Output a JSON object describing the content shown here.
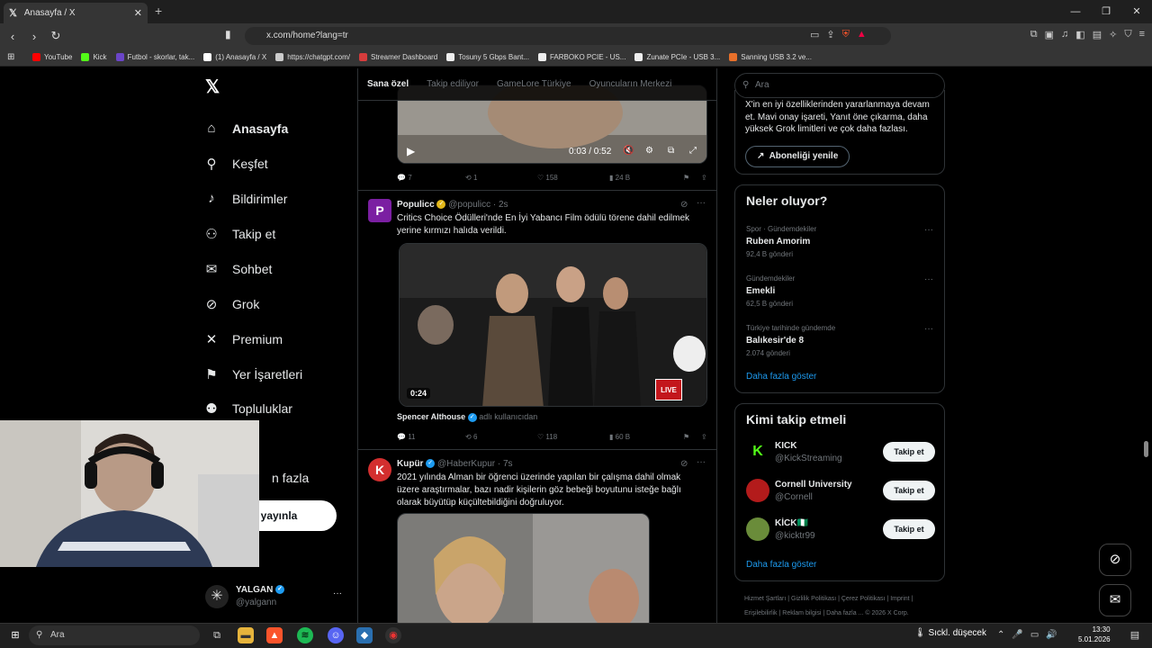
{
  "browser": {
    "tab_title": "Anasayfa / X",
    "tab_close": "✕",
    "new_tab": "+",
    "url": "x.com/home?lang=tr",
    "bookmarks": [
      {
        "label": "YouTube",
        "color": "#ff0000"
      },
      {
        "label": "Kick",
        "color": "#53fc18"
      },
      {
        "label": "Futbol - skorlar, tak...",
        "color": "#6b45c8"
      },
      {
        "label": "(1) Anasayfa / X",
        "color": "#ffffff"
      },
      {
        "label": "https://chatgpt.com/",
        "color": "#cccccc"
      },
      {
        "label": "Streamer Dashboard",
        "color": "#d63c3c"
      },
      {
        "label": "Tosuny 5 Gbps Bant...",
        "color": "#eeeeee"
      },
      {
        "label": "FARBOKO PCIE - US...",
        "color": "#eeeeee"
      },
      {
        "label": "Zunate PCIe - USB 3...",
        "color": "#eeeeee"
      },
      {
        "label": "Sanning USB 3.2 ve...",
        "color": "#e8702a"
      }
    ]
  },
  "nav": {
    "items": [
      {
        "label": "Anasayfa",
        "icon": "home-icon",
        "glyph": "⌂"
      },
      {
        "label": "Keşfet",
        "icon": "search-icon",
        "glyph": "⚲"
      },
      {
        "label": "Bildirimler",
        "icon": "bell-icon",
        "glyph": "♪"
      },
      {
        "label": "Takip et",
        "icon": "follow-icon",
        "glyph": "⚇"
      },
      {
        "label": "Sohbet",
        "icon": "mail-icon",
        "glyph": "✉"
      },
      {
        "label": "Grok",
        "icon": "grok-icon",
        "glyph": "⊘"
      },
      {
        "label": "Premium",
        "icon": "x-icon",
        "glyph": "✕"
      },
      {
        "label": "Yer İşaretleri",
        "icon": "bookmark-icon",
        "glyph": "⚑"
      },
      {
        "label": "Topluluklar",
        "icon": "communities-icon",
        "glyph": "⚉"
      },
      {
        "label": "",
        "icon": "profile-icon",
        "glyph": ""
      },
      {
        "label": "n fazla",
        "icon": "more-icon",
        "glyph": ""
      }
    ],
    "post_button": "eri yayınla",
    "account_name": "YALGAN",
    "account_handle": "@yalgann",
    "account_more": "···"
  },
  "feed": {
    "tabs": [
      "Sana özel",
      "Takip ediliyor",
      "GameLore Türkiye",
      "Oyuncuların Merkezi"
    ],
    "video_time": "0:03 / 0:52",
    "first_actions": {
      "replies": "7",
      "reposts": "1",
      "likes": "158",
      "views": "24 B"
    },
    "tweets": [
      {
        "name": "Populicc",
        "handle": "@populicc",
        "time": "· 2s",
        "text": "Critics Choice Ödülleri'nde En İyi Yabancı Film ödülü törene dahil edilmek yerine kırmızı halıda verildi.",
        "duration": "0:24",
        "live": "LIVE",
        "credit_name": "Spencer Althouse",
        "credit_note": "adlı kullanıcıdan",
        "actions": {
          "replies": "11",
          "reposts": "6",
          "likes": "118",
          "views": "60 B"
        }
      },
      {
        "name": "Kupür",
        "handle": "@HaberKupur",
        "time": "· 7s",
        "text": "2021 yılında Alman bir öğrenci üzerinde yapılan bir çalışma dahil olmak üzere araştırmalar, bazı nadir kişilerin göz bebeği boyutunu isteğe bağlı olarak büyütüp küçültebildiğini doğruluyor."
      }
    ]
  },
  "right": {
    "search_placeholder": "Ara",
    "premium_text": "X'in en iyi özelliklerinden yararlanmaya devam et. Mavi onay işareti, Yanıt öne çıkarma, daha yüksek Grok limitleri ve çok daha fazlası.",
    "renew_button": "Aboneliği yenile",
    "trends_title": "Neler oluyor?",
    "trends": [
      {
        "category": "Spor · Gündemdekiler",
        "name": "Ruben Amorim",
        "count": "92,4 B gönderi"
      },
      {
        "category": "Gündemdekiler",
        "name": "Emekli",
        "count": "62,5 B gönderi"
      },
      {
        "category": "Türkiye tarihinde gündemde",
        "name": "Balıkesir'de 8",
        "count": "2.074 gönderi"
      }
    ],
    "show_more": "Daha fazla göster",
    "follow_title": "Kimi takip etmeli",
    "follow": [
      {
        "name": "KICK",
        "handle": "@KickStreaming",
        "button": "Takip et",
        "color": "#000000"
      },
      {
        "name": "Cornell University",
        "handle": "@Cornell",
        "button": "Takip et",
        "color": "#b31b1b"
      },
      {
        "name": "KİCK🇳🇬",
        "handle": "@kicktr99",
        "button": "Takip et",
        "color": "#6a8c3a"
      }
    ],
    "follow_more": "Daha fazla göster",
    "footer": "Hizmet Şartları  |  Gizlilik Politikası  |  Çerez Politikası  |  Imprint  |  Erişilebilirlik  |  Reklam bilgisi  |  Daha fazla ...  © 2026 X Corp."
  },
  "taskbar": {
    "search": "Ara",
    "weather": "Sıckl. düşecek",
    "time": "13:30",
    "date": "5.01.2026"
  }
}
